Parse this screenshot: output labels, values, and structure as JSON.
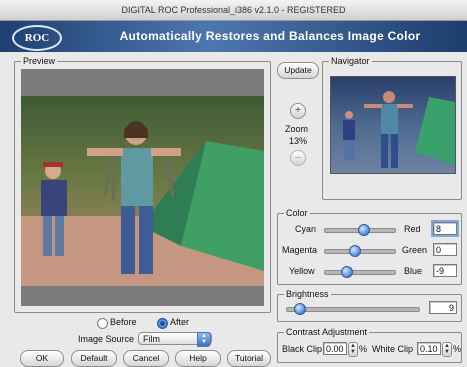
{
  "window": {
    "title": "DIGITAL ROC Professional_i386 v2.1.0 - REGISTERED"
  },
  "banner": {
    "logo": "ROC",
    "tagline": "Automatically Restores and Balances Image Color"
  },
  "preview": {
    "legend": "Preview",
    "radio_before": "Before",
    "radio_after": "After",
    "selected_mode": "After",
    "source_label": "Image Source",
    "source_value": "Film"
  },
  "navigator": {
    "legend": "Navigator",
    "update_button": "Update",
    "zoom_in": "+",
    "zoom_label": "Zoom",
    "zoom_value": "13%",
    "zoom_out": "–"
  },
  "color": {
    "legend": "Color",
    "rows": [
      {
        "left": "Cyan",
        "right": "Red",
        "value": "8",
        "slider_level": 0.55
      },
      {
        "left": "Magenta",
        "right": "Green",
        "value": "0",
        "slider_level": 0.42
      },
      {
        "left": "Yellow",
        "right": "Blue",
        "value": "-9",
        "slider_level": 0.3
      }
    ]
  },
  "brightness": {
    "legend": "Brightness",
    "value": "9",
    "slider_level": 0.08
  },
  "contrast": {
    "legend": "Contrast Adjustment",
    "black_label": "Black Clip",
    "black_value": "0.00",
    "black_unit": "%",
    "white_label": "White Clip",
    "white_value": "0.10",
    "white_unit": "%"
  },
  "footer": {
    "ok": "OK",
    "default": "Default",
    "cancel": "Cancel",
    "help": "Help",
    "tutorial": "Tutorial"
  },
  "colors": {
    "banner": "#2b4f86",
    "accent": "#4f88d8"
  }
}
